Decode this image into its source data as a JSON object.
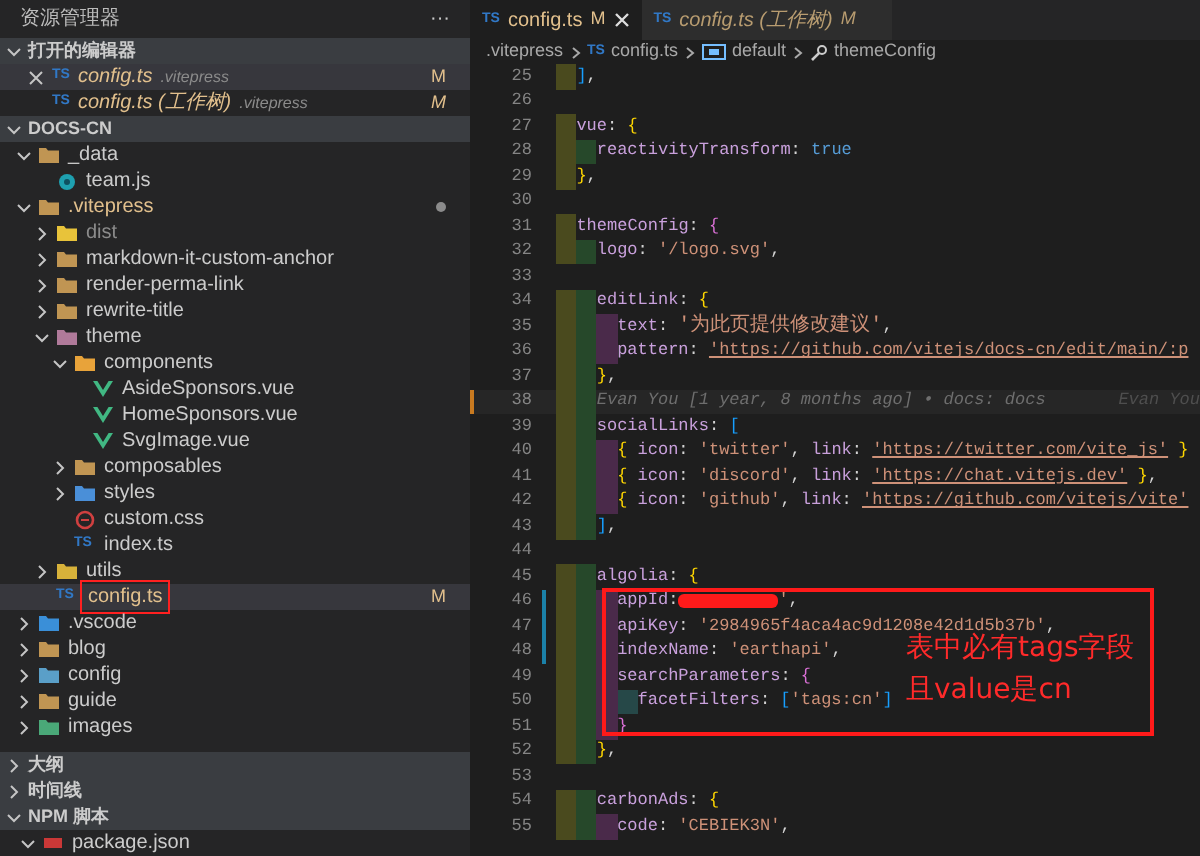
{
  "sidebar": {
    "title": "资源管理器",
    "more": "···",
    "open_editors": {
      "title": "打开的编辑器",
      "expanded": true,
      "items": [
        {
          "icon": "TS",
          "name": "config.ts",
          "path": ".vitepress",
          "status": "M",
          "selected": true,
          "close_shown": true
        },
        {
          "icon": "TS",
          "name": "config.ts (工作树)",
          "path": ".vitepress",
          "status": "M",
          "selected": false,
          "close_shown": false
        }
      ]
    },
    "explorer": {
      "title": "DOCS-CN",
      "expanded": true,
      "tree": [
        {
          "label": "_data",
          "kind": "folder",
          "color": "#c09553",
          "expanded": true,
          "children": [
            {
              "label": "team.js",
              "kind": "js"
            }
          ]
        },
        {
          "label": ".vitepress",
          "kind": "folder",
          "color": "#c09553",
          "expanded": true,
          "modified": true,
          "dot": true,
          "children": [
            {
              "label": "dist",
              "kind": "folder",
              "color": "#e8c33a",
              "expanded": false,
              "dimmed": true
            },
            {
              "label": "markdown-it-custom-anchor",
              "kind": "folder",
              "color": "#c09553",
              "expanded": false
            },
            {
              "label": "render-perma-link",
              "kind": "folder",
              "color": "#c09553",
              "expanded": false
            },
            {
              "label": "rewrite-title",
              "kind": "folder",
              "color": "#c09553",
              "expanded": false
            },
            {
              "label": "theme",
              "kind": "folder",
              "color": "#b07a9a",
              "expanded": true,
              "children": [
                {
                  "label": "components",
                  "kind": "folder",
                  "color": "#e8a33a",
                  "expanded": true,
                  "children": [
                    {
                      "label": "AsideSponsors.vue",
                      "kind": "vue"
                    },
                    {
                      "label": "HomeSponsors.vue",
                      "kind": "vue"
                    },
                    {
                      "label": "SvgImage.vue",
                      "kind": "vue"
                    }
                  ]
                },
                {
                  "label": "composables",
                  "kind": "folder",
                  "color": "#c09553",
                  "expanded": false
                },
                {
                  "label": "styles",
                  "kind": "folder",
                  "color": "#4a8fd8",
                  "expanded": false
                },
                {
                  "label": "custom.css",
                  "kind": "css"
                },
                {
                  "label": "index.ts",
                  "kind": "ts",
                  "icon": "TS"
                }
              ]
            },
            {
              "label": "utils",
              "kind": "folder",
              "color": "#d8b23a",
              "expanded": false
            },
            {
              "label": "config.ts",
              "kind": "ts",
              "icon": "TS",
              "modified": true,
              "status": "M",
              "selected": true,
              "highlighted": true
            }
          ]
        },
        {
          "label": ".vscode",
          "kind": "folder",
          "color": "#3a8fd8",
          "expanded": false
        },
        {
          "label": "blog",
          "kind": "folder",
          "color": "#c09553",
          "expanded": false
        },
        {
          "label": "config",
          "kind": "folder",
          "color": "#5a9fc8",
          "expanded": false
        },
        {
          "label": "guide",
          "kind": "folder",
          "color": "#c09553",
          "expanded": false
        },
        {
          "label": "images",
          "kind": "folder",
          "color": "#4aa878",
          "expanded": false
        }
      ]
    },
    "panels": [
      {
        "title": "大纲",
        "expanded": false
      },
      {
        "title": "时间线",
        "expanded": false
      },
      {
        "title": "NPM 脚本",
        "expanded": true,
        "children": [
          {
            "label": "package.json",
            "expanded": true
          }
        ]
      }
    ]
  },
  "editor": {
    "tabs": [
      {
        "icon": "TS",
        "label": "config.ts",
        "status": "M",
        "selected": true
      },
      {
        "icon": "TS",
        "label": "config.ts (工作树)",
        "status": "M",
        "selected": false
      }
    ],
    "breadcrumb": [
      {
        "kind": "folder",
        "label": ".vitepress"
      },
      {
        "kind": "file",
        "icon": "TS",
        "label": "config.ts"
      },
      {
        "kind": "symbol",
        "label": "default"
      },
      {
        "kind": "property",
        "label": "themeConfig"
      }
    ],
    "lines": [
      {
        "n": "25",
        "tokens": [
          {
            "text": "  ]",
            "kind": "b3"
          },
          {
            "text": ",",
            "kind": "p"
          }
        ]
      },
      {
        "n": "26"
      },
      {
        "n": "27",
        "tokens": [
          {
            "text": "  vue",
            "kind": "k"
          },
          {
            "text": ":",
            "kind": "p"
          },
          {
            "text": "{",
            "kind": "b1"
          }
        ]
      },
      {
        "n": "28",
        "tokens": [
          {
            "text": "    reactivityTransform",
            "kind": "k"
          },
          {
            "text": ":",
            "kind": "p"
          },
          {
            "text": "true",
            "kind": "v"
          }
        ]
      },
      {
        "n": "29",
        "tokens": [
          {
            "text": "  }",
            "kind": "b1"
          },
          {
            "text": ",",
            "kind": "p"
          }
        ]
      },
      {
        "n": "30"
      },
      {
        "n": "31",
        "tokens": [
          {
            "text": "  themeConfig",
            "kind": "k"
          },
          {
            "text": ":",
            "kind": "p"
          },
          {
            "text": "{",
            "kind": "b2"
          }
        ]
      },
      {
        "n": "32",
        "tokens": [
          {
            "text": "    logo",
            "kind": "k"
          },
          {
            "text": ":",
            "kind": "p"
          },
          {
            "text": "'/logo.svg'",
            "kind": "s"
          },
          {
            "text": ",",
            "kind": "p"
          }
        ]
      },
      {
        "n": "33"
      },
      {
        "n": "34",
        "tokens": [
          {
            "text": "    editLink",
            "kind": "k"
          },
          {
            "text": ":",
            "kind": "p"
          },
          {
            "text": "{",
            "kind": "b1"
          }
        ]
      },
      {
        "n": "35",
        "tokens": [
          {
            "text": "      text",
            "kind": "k"
          },
          {
            "text": ":",
            "kind": "p"
          },
          {
            "text": "'为此页提供修改建议'",
            "kind": "s"
          },
          {
            "text": ",",
            "kind": "p"
          }
        ]
      },
      {
        "n": "36",
        "tokens": [
          {
            "text": "      pattern",
            "kind": "k"
          },
          {
            "text": ":",
            "kind": "p"
          },
          {
            "text": "'https://github.com/vitejs/docs-cn/edit/main/:p",
            "kind": "u"
          }
        ]
      },
      {
        "n": "37",
        "tokens": [
          {
            "text": "    }",
            "kind": "b1"
          },
          {
            "text": ",",
            "kind": "p"
          }
        ]
      },
      {
        "n": "38",
        "current": true,
        "tokens": [
          {
            "text": "    Evan You [1 year, 8 months ago] • docs: docs",
            "kind": "blame"
          }
        ],
        "blame_right": "Evan You"
      },
      {
        "n": "39",
        "tokens": [
          {
            "text": "    socialLinks",
            "kind": "k"
          },
          {
            "text": ":",
            "kind": "p"
          },
          {
            "text": "[",
            "kind": "b3"
          }
        ]
      },
      {
        "n": "40",
        "tokens": [
          {
            "text": "      {",
            "kind": "b1"
          },
          {
            "text": "icon",
            "kind": "k"
          },
          {
            "text": ":",
            "kind": "p"
          },
          {
            "text": "'twitter'",
            "kind": "s"
          },
          {
            "text": ",",
            "kind": "p"
          },
          {
            "text": "link",
            "kind": "k"
          },
          {
            "text": ":",
            "kind": "p"
          },
          {
            "text": "'https://twitter.com/vite_js'",
            "kind": "u"
          },
          {
            "text": "}",
            "kind": "b1"
          }
        ]
      },
      {
        "n": "41",
        "tokens": [
          {
            "text": "      {",
            "kind": "b1"
          },
          {
            "text": "icon",
            "kind": "k"
          },
          {
            "text": ":",
            "kind": "p"
          },
          {
            "text": "'discord'",
            "kind": "s"
          },
          {
            "text": ",",
            "kind": "p"
          },
          {
            "text": "link",
            "kind": "k"
          },
          {
            "text": ":",
            "kind": "p"
          },
          {
            "text": "'https://chat.vitejs.dev'",
            "kind": "u"
          },
          {
            "text": "}",
            "kind": "b1"
          },
          {
            "text": ",",
            "kind": "p"
          }
        ]
      },
      {
        "n": "42",
        "tokens": [
          {
            "text": "      {",
            "kind": "b1"
          },
          {
            "text": "icon",
            "kind": "k"
          },
          {
            "text": ":",
            "kind": "p"
          },
          {
            "text": "'github'",
            "kind": "s"
          },
          {
            "text": ",",
            "kind": "p"
          },
          {
            "text": "link",
            "kind": "k"
          },
          {
            "text": ":",
            "kind": "p"
          },
          {
            "text": "'https://github.com/vitejs/vite'",
            "kind": "u"
          }
        ]
      },
      {
        "n": "43",
        "tokens": [
          {
            "text": "    ]",
            "kind": "b3"
          },
          {
            "text": ",",
            "kind": "p"
          }
        ]
      },
      {
        "n": "44"
      },
      {
        "n": "45",
        "tokens": [
          {
            "text": "    algolia",
            "kind": "k"
          },
          {
            "text": ":",
            "kind": "p"
          },
          {
            "text": "{",
            "kind": "b1"
          }
        ]
      },
      {
        "n": "46",
        "changed": true,
        "tokens": [
          {
            "text": "      appId",
            "kind": "k"
          },
          {
            "text": ":",
            "kind": "p"
          },
          {
            "kind": "redacted"
          },
          {
            "text": "'",
            "kind": "s"
          },
          {
            "text": ",",
            "kind": "p"
          }
        ]
      },
      {
        "n": "47",
        "changed": true,
        "tokens": [
          {
            "text": "      apiKey",
            "kind": "k"
          },
          {
            "text": ":",
            "kind": "p"
          },
          {
            "text": "'2984965f4aca4ac9d1208e42d1d5b37b'",
            "kind": "s"
          },
          {
            "text": ",",
            "kind": "p"
          }
        ]
      },
      {
        "n": "48",
        "changed": true,
        "tokens": [
          {
            "text": "      indexName",
            "kind": "k"
          },
          {
            "text": ":",
            "kind": "p"
          },
          {
            "text": "'earthapi'",
            "kind": "s"
          },
          {
            "text": ",",
            "kind": "p"
          }
        ]
      },
      {
        "n": "49",
        "tokens": [
          {
            "text": "      searchParameters",
            "kind": "k"
          },
          {
            "text": ":",
            "kind": "p"
          },
          {
            "text": "{",
            "kind": "b2"
          }
        ]
      },
      {
        "n": "50",
        "tokens": [
          {
            "text": "        facetFilters",
            "kind": "k"
          },
          {
            "text": ":",
            "kind": "p"
          },
          {
            "text": "[",
            "kind": "b3"
          },
          {
            "text": "'tags:cn'",
            "kind": "s"
          },
          {
            "text": "]",
            "kind": "b3"
          }
        ]
      },
      {
        "n": "51",
        "tokens": [
          {
            "text": "      }",
            "kind": "b2"
          }
        ]
      },
      {
        "n": "52",
        "tokens": [
          {
            "text": "    }",
            "kind": "b1"
          },
          {
            "text": ",",
            "kind": "p"
          }
        ]
      },
      {
        "n": "53"
      },
      {
        "n": "54",
        "tokens": [
          {
            "text": "    carbonAds",
            "kind": "k"
          },
          {
            "text": ":",
            "kind": "p"
          },
          {
            "text": "{",
            "kind": "b1"
          }
        ]
      },
      {
        "n": "55",
        "tokens": [
          {
            "text": "      code",
            "kind": "k"
          },
          {
            "text": ":",
            "kind": "p"
          },
          {
            "text": "'CEBIEK3N'",
            "kind": "s"
          },
          {
            "text": ",",
            "kind": "p"
          }
        ]
      }
    ],
    "annotation": {
      "lines": [
        "表中必有tags字段",
        "且value是cn"
      ]
    }
  }
}
